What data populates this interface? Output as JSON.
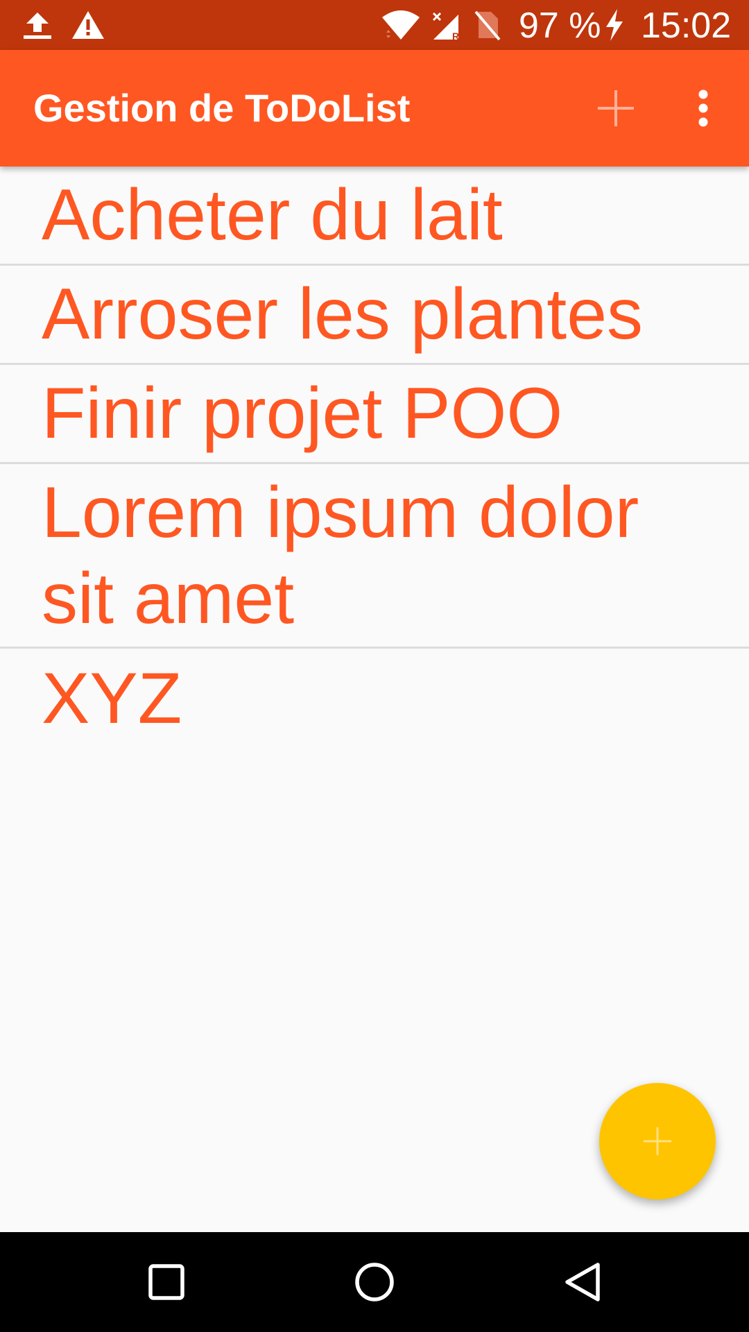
{
  "status_bar": {
    "icons": [
      "upload-icon",
      "warning-icon",
      "wifi-icon",
      "cellular-no-signal-icon",
      "no-sim-icon",
      "battery-charging-icon"
    ],
    "battery": "97 %",
    "time": "15:02",
    "background_color": "#bf360c"
  },
  "app_bar": {
    "title": "Gestion de ToDoList",
    "actions": [
      "add-icon",
      "more-vert-icon"
    ],
    "background_color": "#ff5722"
  },
  "todo_list": {
    "items": [
      {
        "label": "Acheter du lait"
      },
      {
        "label": "Arroser les plantes"
      },
      {
        "label": "Finir projet POO"
      },
      {
        "label": "Lorem ipsum dolor sit amet"
      },
      {
        "label": "XYZ"
      }
    ],
    "text_color": "#ff5722"
  },
  "fab": {
    "icon": "add-icon",
    "background_color": "#ffc400"
  },
  "nav_bar": {
    "buttons": [
      "recents-square-icon",
      "home-circle-icon",
      "back-triangle-icon"
    ]
  }
}
